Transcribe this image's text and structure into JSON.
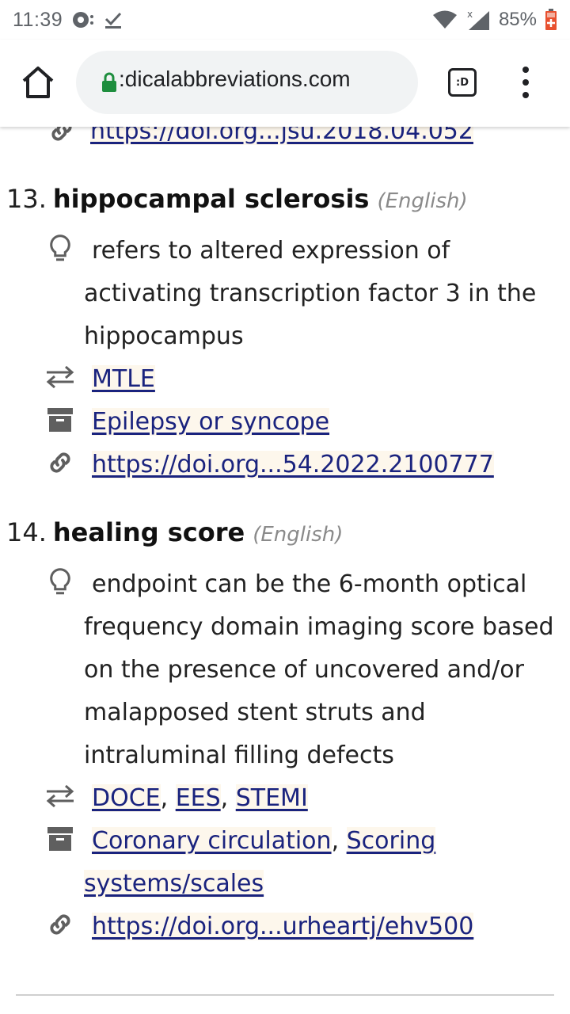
{
  "status_bar": {
    "time": "11:39",
    "battery": "85%",
    "icons": [
      "message-icon",
      "check-icon",
      "wifi-icon",
      "signal-icon",
      "battery-icon"
    ]
  },
  "browser": {
    "url": ":dicalabbreviations.com",
    "tab_label": ":D",
    "accent": "#1e8e3e"
  },
  "cut_link": "https://doi.org...jsu.2018.04.052",
  "entries": [
    {
      "number": "13.",
      "term": "hippocampal sclerosis",
      "language": "(English)",
      "definition": "refers to altered expression of activating transcription factor 3 in the hippocampus",
      "abbreviations": [
        "MTLE"
      ],
      "categories": [
        "Epilepsy or syncope"
      ],
      "doi": "https://doi.org...54.2022.2100777"
    },
    {
      "number": "14.",
      "term": "healing score",
      "language": "(English)",
      "definition": "endpoint can be the 6-month optical frequency domain imaging score based on the presence of uncovered and/or malapposed stent struts and intraluminal filling defects",
      "abbreviations": [
        "DOCE",
        "EES",
        "STEMI"
      ],
      "categories": [
        "Coronary circulation",
        "Scoring systems/scales"
      ],
      "doi": "https://doi.org...urheartj/ehv500"
    }
  ],
  "colors": {
    "link": "#1a237e",
    "muted": "#8a8a8a",
    "icon": "#5f5f5f"
  }
}
